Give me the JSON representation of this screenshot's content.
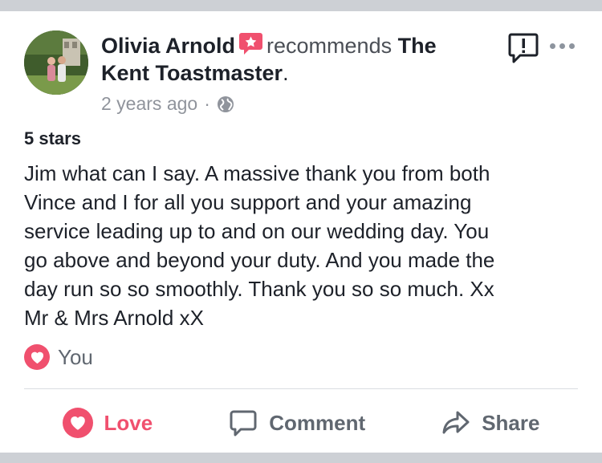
{
  "post": {
    "author": "Olivia Arnold",
    "action_text": "recommends",
    "page_name": "The Kent Toastmaster",
    "trailing_punct": ".",
    "time": "2 years ago",
    "separator": "·",
    "audience_icon": "globe-icon",
    "header_icons": {
      "report": "report-icon",
      "more": "more-icon"
    }
  },
  "review": {
    "rating": "5 stars",
    "text": "Jim what can I say. A massive thank you from both\nVince and I for all you support and your amazing\nservice  leading up to and on our wedding day. You\ngo above and beyond your duty. And you made the\nday run so so smoothly. Thank you so so much. Xx\nMr & Mrs Arnold xX"
  },
  "reactions": {
    "icon": "heart-icon",
    "label": "You"
  },
  "actions": {
    "love": "Love",
    "comment": "Comment",
    "share": "Share"
  },
  "colors": {
    "love": "#f0506e",
    "text": "#1d2129",
    "muted": "#90949c"
  }
}
